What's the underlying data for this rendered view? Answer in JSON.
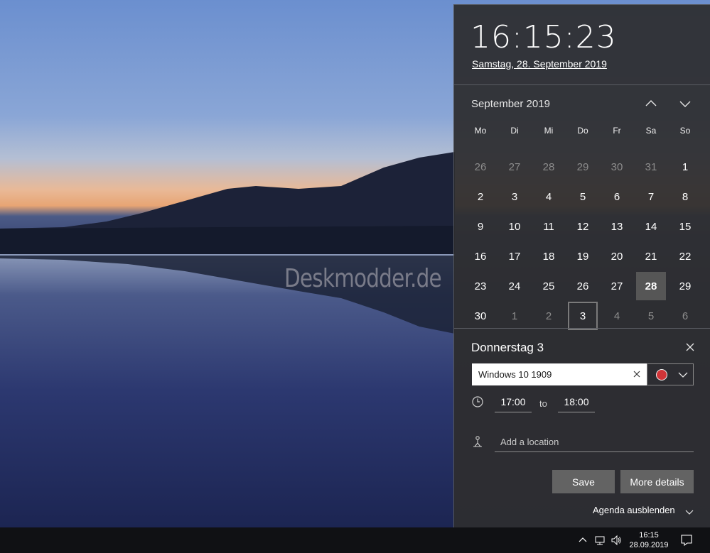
{
  "desktop": {
    "watermark": "Deskmodder.de"
  },
  "flyout": {
    "time": "16:15:23",
    "date": "Samstag, 28. September 2019"
  },
  "calendar": {
    "month": "September 2019",
    "weekdays": [
      "Mo",
      "Di",
      "Mi",
      "Do",
      "Fr",
      "Sa",
      "So"
    ],
    "days": [
      {
        "n": "26",
        "dim": true
      },
      {
        "n": "27",
        "dim": true
      },
      {
        "n": "28",
        "dim": true
      },
      {
        "n": "29",
        "dim": true
      },
      {
        "n": "30",
        "dim": true
      },
      {
        "n": "31",
        "dim": true
      },
      {
        "n": "1"
      },
      {
        "n": "2"
      },
      {
        "n": "3"
      },
      {
        "n": "4"
      },
      {
        "n": "5"
      },
      {
        "n": "6"
      },
      {
        "n": "7"
      },
      {
        "n": "8"
      },
      {
        "n": "9"
      },
      {
        "n": "10"
      },
      {
        "n": "11"
      },
      {
        "n": "12"
      },
      {
        "n": "13"
      },
      {
        "n": "14"
      },
      {
        "n": "15"
      },
      {
        "n": "16"
      },
      {
        "n": "17"
      },
      {
        "n": "18"
      },
      {
        "n": "19"
      },
      {
        "n": "20"
      },
      {
        "n": "21"
      },
      {
        "n": "22"
      },
      {
        "n": "23"
      },
      {
        "n": "24"
      },
      {
        "n": "25"
      },
      {
        "n": "26"
      },
      {
        "n": "27"
      },
      {
        "n": "28",
        "today": true
      },
      {
        "n": "29"
      },
      {
        "n": "30"
      },
      {
        "n": "1",
        "dim": true
      },
      {
        "n": "2",
        "dim": true
      },
      {
        "n": "3",
        "selected": true
      },
      {
        "n": "4",
        "dim": true
      },
      {
        "n": "5",
        "dim": true
      },
      {
        "n": "6",
        "dim": true
      }
    ]
  },
  "event": {
    "title": "Donnerstag 3",
    "name_value": "Windows 10 1909",
    "color": "#d13438",
    "start": "17:00",
    "to_label": "to",
    "end": "18:00",
    "location_placeholder": "Add a location",
    "save_label": "Save",
    "details_label": "More details",
    "agenda_label": "Agenda ausblenden"
  },
  "taskbar": {
    "time": "16:15",
    "date": "28.09.2019"
  }
}
